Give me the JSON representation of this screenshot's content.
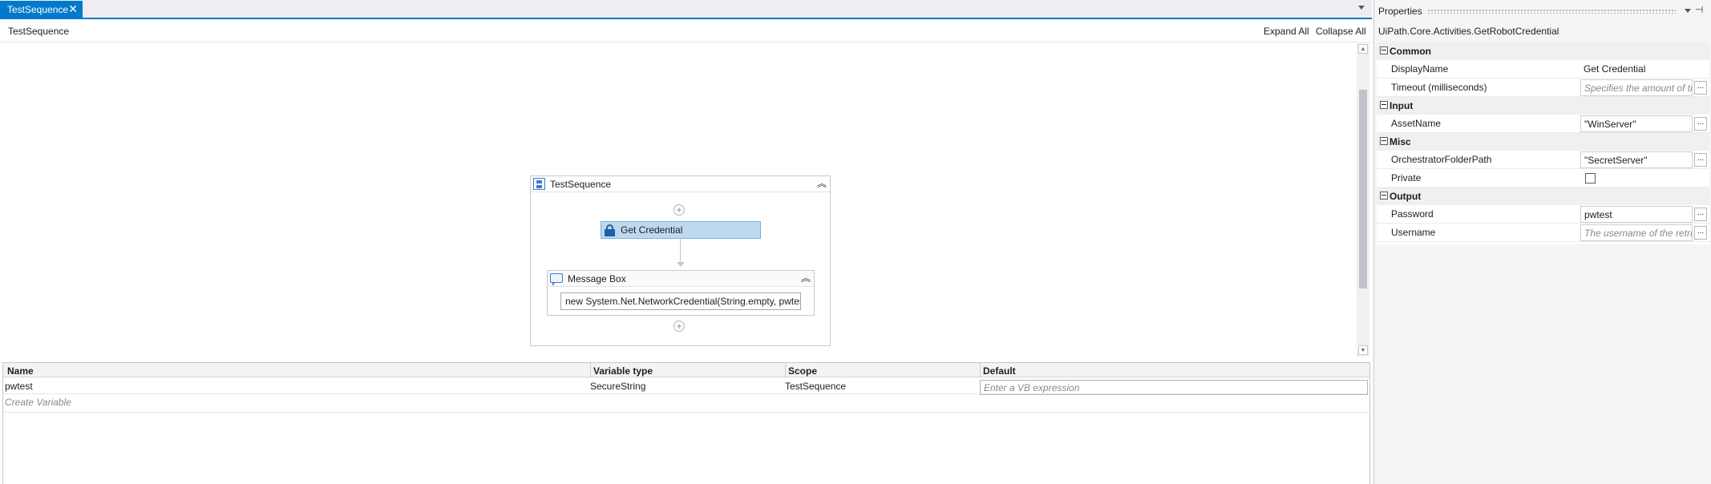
{
  "designer": {
    "tab_title": "TestSequence",
    "tab_close": "✕",
    "breadcrumb": "TestSequence",
    "expand_all": "Expand All",
    "collapse_all": "Collapse All"
  },
  "workflow": {
    "sequence_title": "TestSequence",
    "activity_title": "Get Credential",
    "message_box_title": "Message Box",
    "message_box_text": "new System.Net.NetworkCredential(String.empty, pwtest).Password",
    "add_glyph": "+"
  },
  "variables": {
    "headers": [
      "Name",
      "Variable type",
      "Scope",
      "Default"
    ],
    "rows": [
      {
        "name": "pwtest",
        "type": "SecureString",
        "scope": "TestSequence",
        "default_placeholder": "Enter a VB expression"
      }
    ],
    "create_label": "Create Variable"
  },
  "properties": {
    "panel_title": "Properties",
    "pin_glyph": "⊣",
    "type_name": "UiPath.Core.Activities.GetRobotCredential",
    "ellipsis": "...",
    "categories": [
      {
        "label": "Common",
        "items": [
          {
            "name": "DisplayName",
            "value": "Get Credential"
          },
          {
            "name": "Timeout (milliseconds)",
            "placeholder": "Specifies the amount of time to wait"
          }
        ]
      },
      {
        "label": "Input",
        "items": [
          {
            "name": "AssetName",
            "value": "\"WinServer\""
          }
        ]
      },
      {
        "label": "Misc",
        "items": [
          {
            "name": "OrchestratorFolderPath",
            "value": "\"SecretServer\""
          },
          {
            "name": "Private",
            "checked": false
          }
        ]
      },
      {
        "label": "Output",
        "items": [
          {
            "name": "Password",
            "value": "pwtest"
          },
          {
            "name": "Username",
            "placeholder": "The username of the retrieved credential"
          }
        ]
      }
    ]
  },
  "colors": {
    "accent": "#007acc",
    "selected_activity": "#bdd9ee"
  },
  "icons": [
    "chevron-down-icon",
    "close-icon",
    "sequence-icon",
    "lock-icon",
    "message-box-icon",
    "double-chevron-up-icon",
    "add-icon",
    "pin-icon",
    "collapse-toggle-icon"
  ]
}
